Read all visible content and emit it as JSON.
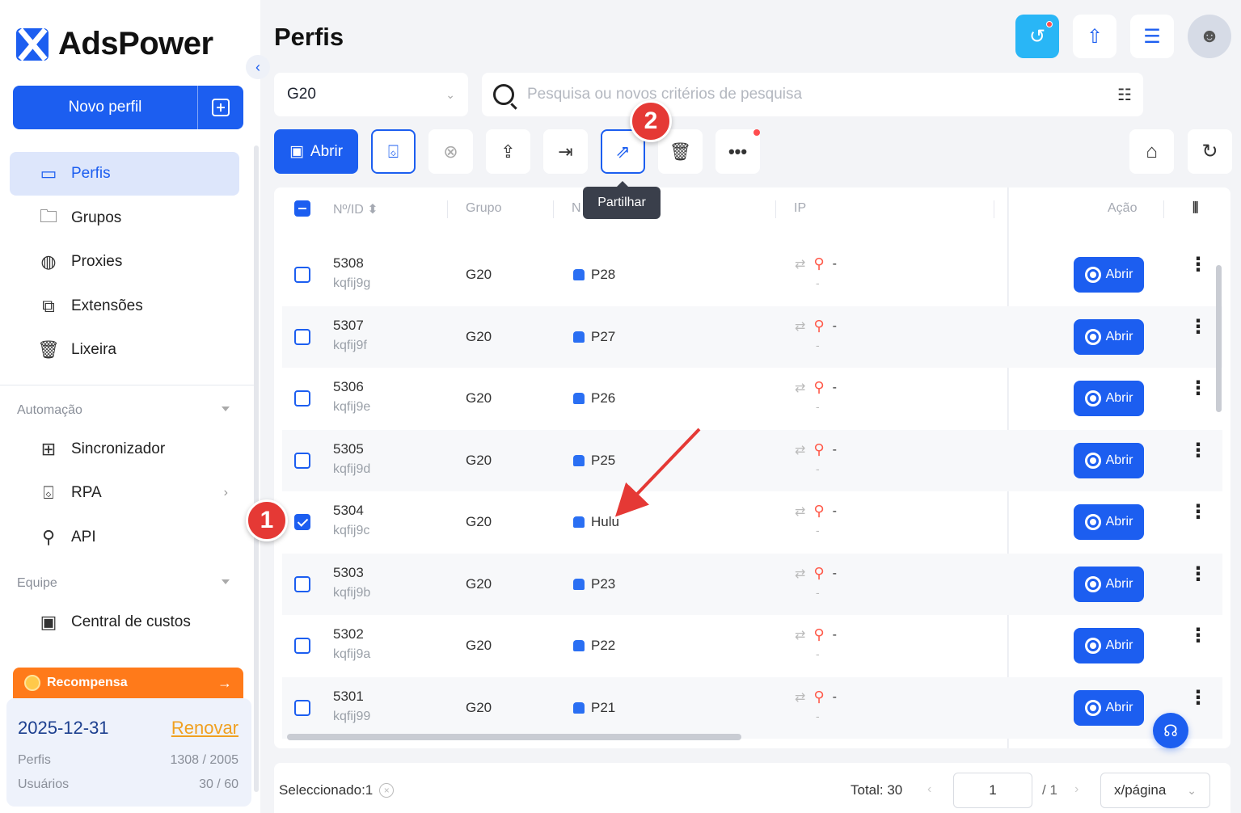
{
  "app": {
    "name": "AdsPower",
    "new_profile_label": "Novo perfil"
  },
  "sidebar": {
    "items": [
      {
        "label": "Perfis",
        "icon": "browser-window-icon"
      },
      {
        "label": "Grupos",
        "icon": "folder-icon"
      },
      {
        "label": "Proxies",
        "icon": "globe-icon"
      },
      {
        "label": "Extensões",
        "icon": "puzzle-icon"
      },
      {
        "label": "Lixeira",
        "icon": "trash-icon"
      }
    ],
    "automation_label": "Automação",
    "automation_items": [
      {
        "label": "Sincronizador",
        "icon": "sync-icon"
      },
      {
        "label": "RPA",
        "icon": "robot-icon"
      },
      {
        "label": "API",
        "icon": "plug-icon"
      }
    ],
    "team_label": "Equipe",
    "team_items": [
      {
        "label": "Central de custos",
        "icon": "wallet-icon"
      }
    ],
    "reward_label": "Recompensa",
    "plan": {
      "expiry": "2025-12-31",
      "renew_label": "Renovar",
      "profiles_label": "Perfis",
      "profiles_value": "1308 / 2005",
      "users_label": "Usuários",
      "users_value": "30 / 60"
    }
  },
  "header": {
    "title": "Perfis"
  },
  "filters": {
    "group_value": "G20",
    "search_placeholder": "Pesquisa ou novos critérios de pesquisa"
  },
  "toolbar": {
    "open_label": "Abrir",
    "share_tooltip": "Partilhar"
  },
  "table": {
    "headers": {
      "id": "Nº/ID",
      "group": "Grupo",
      "name": "N",
      "ip": "IP",
      "action": "Ação"
    },
    "open_label": "Abrir",
    "rows": [
      {
        "num": "5308",
        "id": "kqfij9g",
        "group": "G20",
        "name": "P28",
        "ip": "-",
        "ip2": "-",
        "checked": false
      },
      {
        "num": "5307",
        "id": "kqfij9f",
        "group": "G20",
        "name": "P27",
        "ip": "-",
        "ip2": "-",
        "checked": false
      },
      {
        "num": "5306",
        "id": "kqfij9e",
        "group": "G20",
        "name": "P26",
        "ip": "-",
        "ip2": "-",
        "checked": false
      },
      {
        "num": "5305",
        "id": "kqfij9d",
        "group": "G20",
        "name": "P25",
        "ip": "-",
        "ip2": "-",
        "checked": false
      },
      {
        "num": "5304",
        "id": "kqfij9c",
        "group": "G20",
        "name": "Hulu",
        "ip": "-",
        "ip2": "-",
        "checked": true
      },
      {
        "num": "5303",
        "id": "kqfij9b",
        "group": "G20",
        "name": "P23",
        "ip": "-",
        "ip2": "-",
        "checked": false
      },
      {
        "num": "5302",
        "id": "kqfij9a",
        "group": "G20",
        "name": "P22",
        "ip": "-",
        "ip2": "-",
        "checked": false
      },
      {
        "num": "5301",
        "id": "kqfij99",
        "group": "G20",
        "name": "P21",
        "ip": "-",
        "ip2": "-",
        "checked": false
      }
    ]
  },
  "footer": {
    "selected": "Seleccionado:1",
    "total": "Total: 30",
    "page_value": "1",
    "page_total": "/ 1",
    "per_page": "x/página"
  },
  "annotations": {
    "marker1": "1",
    "marker2": "2"
  },
  "colors": {
    "accent": "#1c5ef0",
    "marker": "#e53935",
    "reward": "#ff7a1a"
  }
}
